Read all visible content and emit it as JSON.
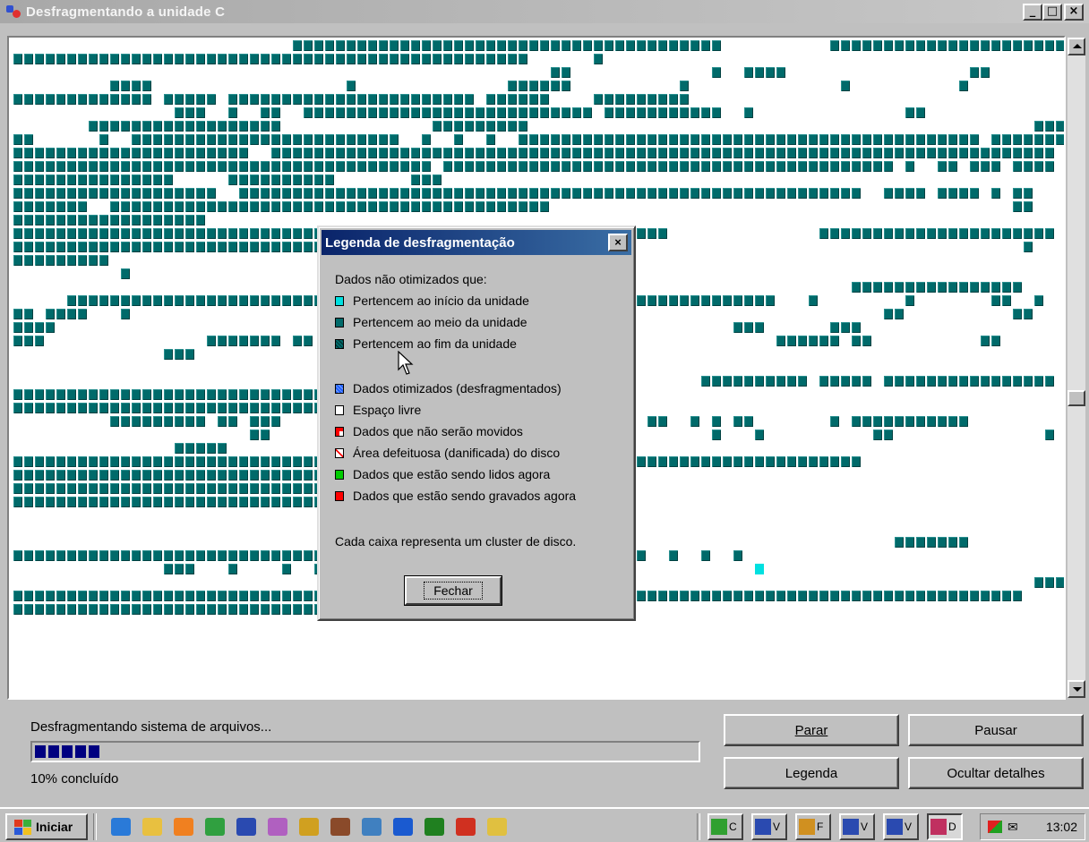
{
  "window": {
    "title": "Desfragmentando a unidade C",
    "minimize_glyph": "_",
    "maximize_glyph": "□",
    "close_glyph": "×"
  },
  "cluster_map": {
    "cluster_color": "#006a6a",
    "highlight_color": "#00e0e0",
    "rows": [
      "..........................########################################..........#######################.",
      "################################################......#..............................................",
      "..................................................##.............#..####.................##...........",
      ".........####..................#..............######..........#..............#..........#.........###..",
      "#############.#####.#######################.######....#########.................................",
      "...............###..#..##..###########################.###########..#..............##...............",
      ".......##################..............#########...............................................#######",
      "##......#..#########################..#..#..#..###########################################.###########",
      "######################..#########################################################################",
      "#######################################.##########################################.#..##.###.####",
      "###############.....##########.......###..........................................................",
      "###################..##########################################################..####.####.#.##",
      "#######..#########################################...........................................##...",
      "##################.....................................................................................",
      "#############################################################..............######################.",
      "###########################################...................................................#...",
      "#########.....................................................................................",
      "..........#.......................................................................................",
      "..............................................................................################.....",
      ".....##########################..............##########################...#........#.......##..#.",
      "##.####...#.........................................##...........................##..........##",
      "####...............................................................###......###................",
      "###...............#######.##...........................................######.##..........##..",
      "..............###.................................................................................",
      "..................................................................................................",
      "................................................................##########.#####.################",
      "################################..................................................................",
      "#############################...................................................................",
      ".........#########.##.###...............................#..##..#.#.##.......#.###########.......",
      "......................##.........................................#...#..........##..............#",
      "...............#####..............................................................................",
      "###############################################################################.....................",
      "#####################################################...........................................",
      "#################################################...................................................",
      "##########################################.....................................................",
      "..................................................................................................",
      "...................................................................................................",
      "..................................................................................#######.",
      "##############################################.#.##.......#..#..#..#...........................",
      "..............###...#....#..##...........#..#..#.............................................",
      "...............................................................................................###",
      "##############################################################################################",
      "##############################..................................................................."
    ],
    "highlights": [
      [
        39,
        69
      ],
      [
        37,
        45
      ]
    ]
  },
  "scrollbar": {
    "thumb_position_fraction": 0.55
  },
  "status": {
    "text": "Desfragmentando sistema de arquivos...",
    "progress_fraction": 0.1,
    "progress_color": "#000080",
    "percent_text": "10% concluído"
  },
  "buttons": {
    "stop": "Parar",
    "pause": "Pausar",
    "legend": "Legenda",
    "hide_details": "Ocultar detalhes"
  },
  "legend_dialog": {
    "title": "Legenda de desfragmentação",
    "close_glyph": "×",
    "heading": "Dados não otimizados que:",
    "items": [
      {
        "label": "Pertencem ao início da unidade",
        "color": "#00e0e0",
        "icon": "cyan-square"
      },
      {
        "label": "Pertencem ao meio da unidade",
        "color": "#006a6a",
        "icon": "teal-square"
      },
      {
        "label": "Pertencem ao fim da unidade",
        "color": "#004a4a",
        "icon": "dark-teal-square"
      },
      {
        "label": "Dados otimizados (desfragmentados)",
        "color": "#2060ff",
        "icon": "blue-square"
      },
      {
        "label": "Espaço livre",
        "color": "#ffffff",
        "icon": "white-square"
      },
      {
        "label": "Dados que não serão movidos",
        "color": "#ff0000",
        "icon": "unmovable-square"
      },
      {
        "label": "Área defeituosa (danificada) do disco",
        "color": "#ff0000",
        "icon": "bad-sector-square"
      },
      {
        "label": "Dados que estão sendo lidos agora",
        "color": "#00cc00",
        "icon": "green-square"
      },
      {
        "label": "Dados que estão sendo gravados agora",
        "color": "#ff0000",
        "icon": "red-square"
      }
    ],
    "footer": "Cada caixa representa um cluster de disco.",
    "close_button": "Fechar"
  },
  "taskbar": {
    "start_label": "Iniciar",
    "quick_launch_icons": [
      "ie-icon",
      "notepad-icon",
      "media-player-icon",
      "app-icon",
      "word-icon",
      "paint-icon",
      "tool-icon",
      "media-icon",
      "disk-icon",
      "eye-icon",
      "chart-icon",
      "zonealarm-icon",
      "folder-icon"
    ],
    "tasks": [
      {
        "label": "C",
        "icon": "app-task-icon"
      },
      {
        "label": "V",
        "icon": "word-task-icon"
      },
      {
        "label": "F",
        "icon": "paint-task-icon"
      },
      {
        "label": "V",
        "icon": "word-task-icon"
      },
      {
        "label": "V",
        "icon": "word-task-icon"
      },
      {
        "label": "D",
        "icon": "defrag-task-icon",
        "active": true
      }
    ],
    "clock": "13:02"
  }
}
